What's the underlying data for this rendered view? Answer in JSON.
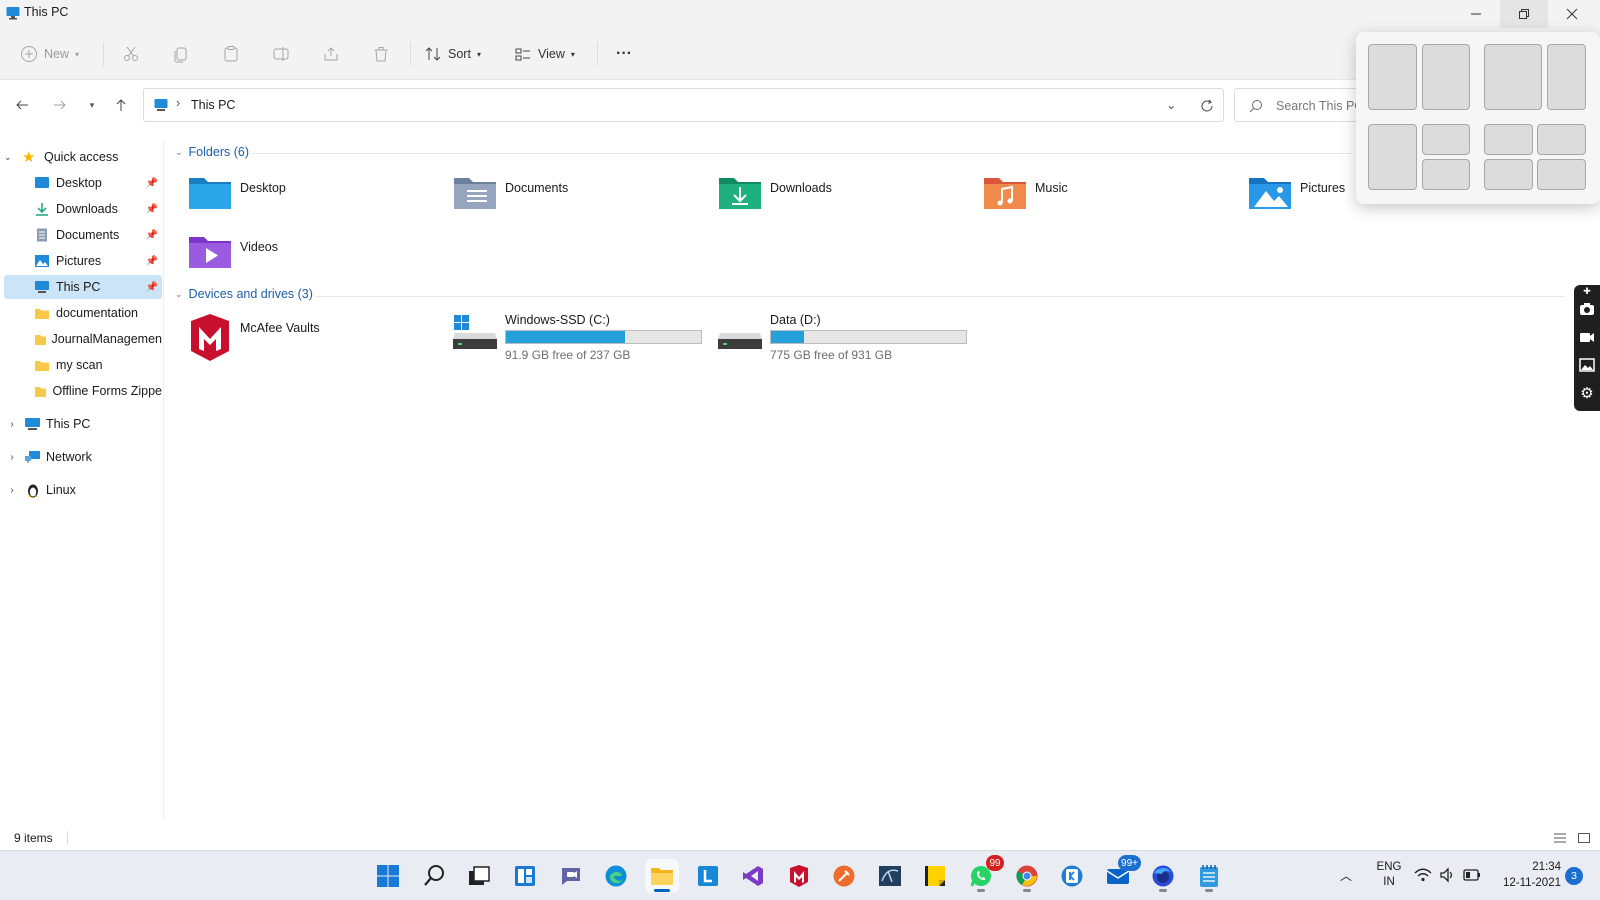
{
  "window": {
    "title": "This PC"
  },
  "toolbar": {
    "new_label": "New",
    "sort_label": "Sort",
    "view_label": "View",
    "more_label": "···"
  },
  "address": {
    "location": "This PC",
    "separator": "›"
  },
  "search": {
    "placeholder": "Search This PC"
  },
  "sidebar": {
    "quick_access": "Quick access",
    "items": [
      {
        "label": "Desktop",
        "icon": "desktop-icon"
      },
      {
        "label": "Downloads",
        "icon": "download-icon"
      },
      {
        "label": "Documents",
        "icon": "documents-icon"
      },
      {
        "label": "Pictures",
        "icon": "pictures-icon"
      },
      {
        "label": "This PC",
        "icon": "monitor-icon"
      },
      {
        "label": "documentation",
        "icon": "folder-icon"
      },
      {
        "label": "JournalManagemen",
        "icon": "folder-icon"
      },
      {
        "label": "my scan",
        "icon": "folder-icon"
      },
      {
        "label": "Offline Forms Zippe",
        "icon": "folder-icon"
      }
    ],
    "roots": [
      {
        "label": "This PC",
        "icon": "monitor-icon"
      },
      {
        "label": "Network",
        "icon": "network-icon"
      },
      {
        "label": "Linux",
        "icon": "linux-icon"
      }
    ]
  },
  "folders": {
    "header": "Folders (6)",
    "items": [
      "Desktop",
      "Documents",
      "Downloads",
      "Music",
      "Pictures",
      "Videos"
    ]
  },
  "drives": {
    "header": "Devices and drives (3)",
    "items": [
      {
        "name": "McAfee Vaults",
        "icon": "mcafee-icon"
      },
      {
        "name": "Windows-SSD (C:)",
        "free_text": "91.9 GB free of 237 GB",
        "used_fraction": 0.61
      },
      {
        "name": "Data (D:)",
        "free_text": "775 GB free of 931 GB",
        "used_fraction": 0.17
      }
    ]
  },
  "status": {
    "items_count": "9 items"
  },
  "taskbar": {
    "whatsapp_badge": "99",
    "mail_badge": "99+",
    "lang_top": "ENG",
    "lang_bottom": "IN",
    "time": "21:34",
    "date": "12-11-2021",
    "notifications": "3"
  },
  "colors": {
    "accent": "#0067c0",
    "selected": "#cce4f7",
    "section_text": "#1d5ea8",
    "drive_bar": "#26a0da"
  }
}
